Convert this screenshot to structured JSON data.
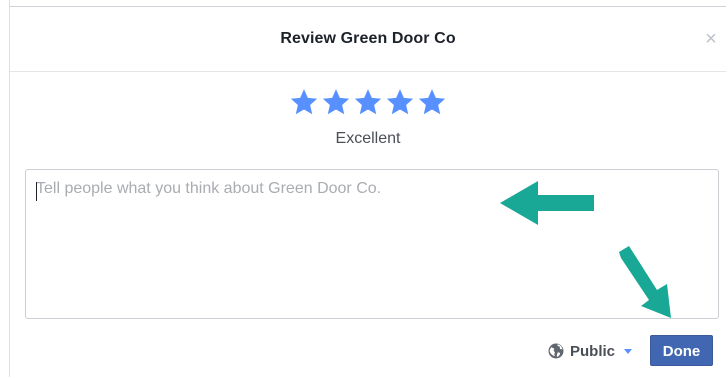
{
  "dialog": {
    "title": "Review Green Door Co",
    "close_glyph": "×"
  },
  "rating": {
    "value": 5,
    "max": 5,
    "label": "Excellent",
    "star_color": "#5890ff"
  },
  "review_input": {
    "placeholder": "Tell people what you think about Green Door Co.",
    "value": ""
  },
  "annotations": {
    "arrow_color": "#1aa896",
    "arrows": [
      "arrow-left",
      "arrow-down-right"
    ]
  },
  "footer": {
    "privacy_label": "Public",
    "privacy_icon": "globe-icon",
    "done_label": "Done",
    "done_color": "#4267b2"
  }
}
